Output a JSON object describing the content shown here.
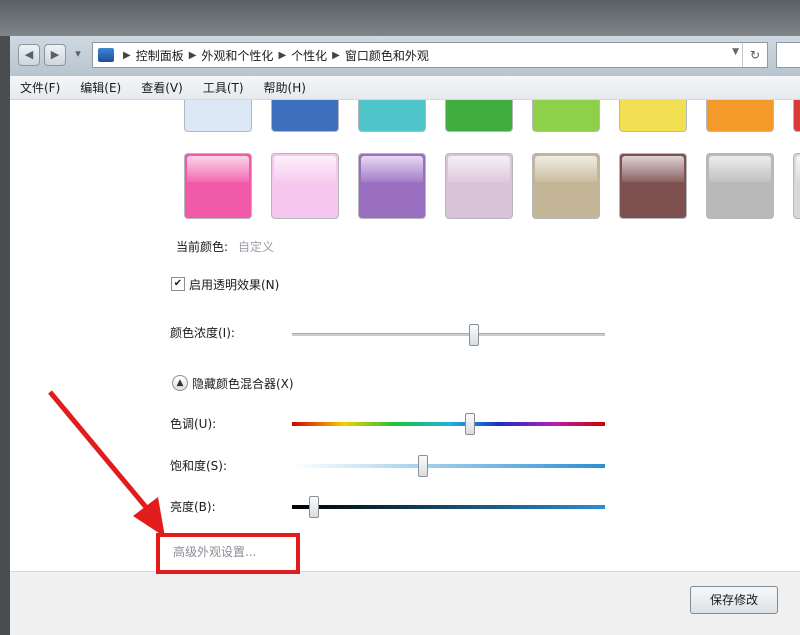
{
  "breadcrumb": [
    "控制面板",
    "外观和个性化",
    "个性化",
    "窗口颜色和外观"
  ],
  "menu": [
    "文件(F)",
    "编辑(E)",
    "查看(V)",
    "工具(T)",
    "帮助(H)"
  ],
  "swatch_colors_row1": [
    "#dde8f7",
    "#3f6fbf",
    "#4ec5c8",
    "#3fae3f",
    "#8fd04a",
    "#f3df52",
    "#f39a2a",
    "#d93a3a"
  ],
  "swatch_colors_row2": [
    "#f05aa8",
    "#f6c6ee",
    "#9a6fc2",
    "#d9c3d8",
    "#c4b596",
    "#7e5050",
    "#b9b9b9",
    "#d8d8d8"
  ],
  "current_color_label": "当前颜色:",
  "current_color_value": "自定义",
  "transparency_label": "启用透明效果(N)",
  "transparency_checked": true,
  "intensity_label": "颜色浓度(I):",
  "intensity_level": 0.58,
  "mixer_toggle_label": "隐藏颜色混合器(X)",
  "hue_label": "色调(U):",
  "hue_level": 0.57,
  "saturation_label": "饱和度(S):",
  "saturation_level": 0.42,
  "brightness_label": "亮度(B):",
  "brightness_level": 0.07,
  "advanced_link": "高级外观设置...",
  "save_button": "保存修改"
}
